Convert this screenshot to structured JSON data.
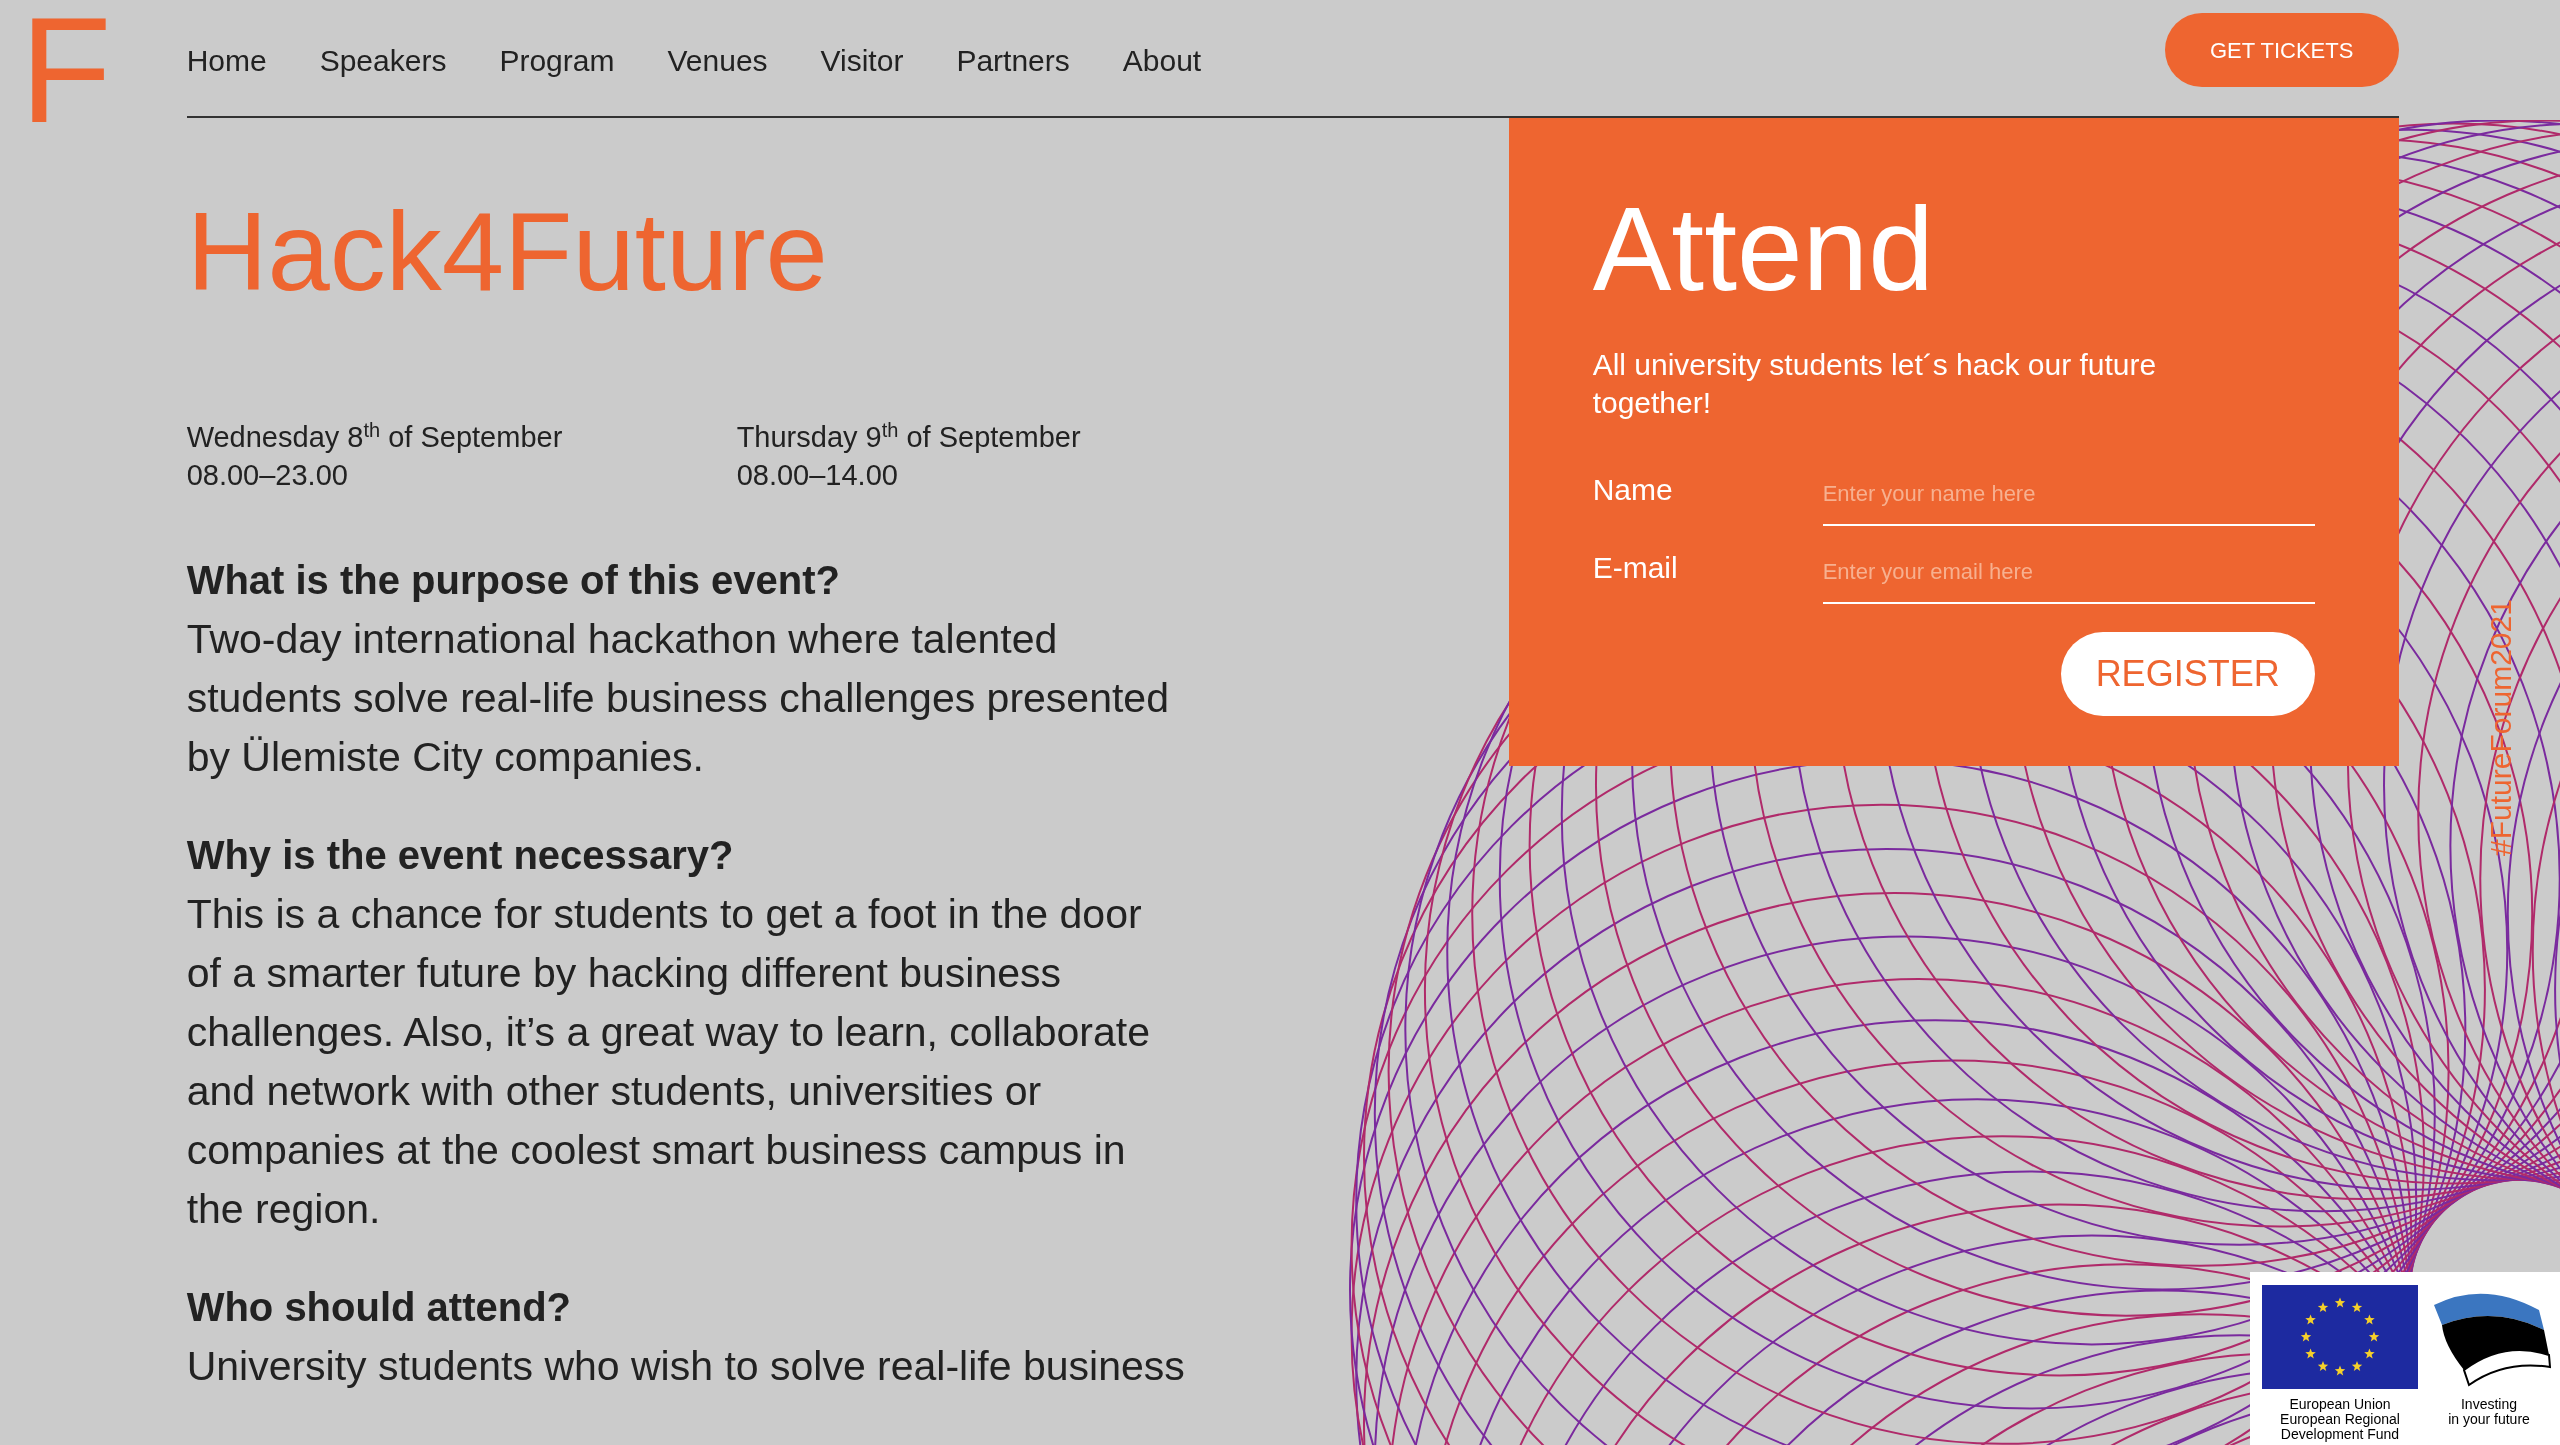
{
  "logo": {
    "text": "F"
  },
  "nav": {
    "items": [
      {
        "label": "Home"
      },
      {
        "label": "Speakers"
      },
      {
        "label": "Program"
      },
      {
        "label": "Venues"
      },
      {
        "label": "Visitor"
      },
      {
        "label": "Partners"
      },
      {
        "label": "About"
      }
    ],
    "cta": "GET TICKETS"
  },
  "event": {
    "title": "Hack4Future",
    "dates": [
      {
        "day": "Wednesday 8$^{th}$ of September",
        "time": "08.00–23.00"
      },
      {
        "day": "Thursday 9$^{th}$ of September",
        "time": "08.00–14.00"
      }
    ],
    "sections": [
      {
        "heading": "What is the purpose of this event?",
        "body": "Two-day international hackathon where talented students solve real-life business challenges presented by Ülemiste City companies."
      },
      {
        "heading": "Why is the event necessary?",
        "body": "This is a chance for students to get a foot in the door of a smarter future by hacking different business challenges. Also, it’s a great way to learn, collaborate and network with other students, universities or companies at the coolest smart business campus in the region."
      },
      {
        "heading": "Who should attend?",
        "body": "University students who wish to solve real-life business"
      }
    ]
  },
  "attend": {
    "title": "Attend",
    "text": "All university students let´s hack our future together!",
    "fields": [
      {
        "label": "Name",
        "placeholder": "Enter your name here"
      },
      {
        "label": "E-mail",
        "placeholder": "Enter your email here"
      }
    ],
    "button": "REGISTER"
  },
  "hashtag": "#FutureForum2021",
  "funding": {
    "eu_caption": [
      "European Union",
      "European Regional",
      "Development Fund"
    ],
    "ee_caption": [
      "Investing",
      "in your future"
    ]
  }
}
